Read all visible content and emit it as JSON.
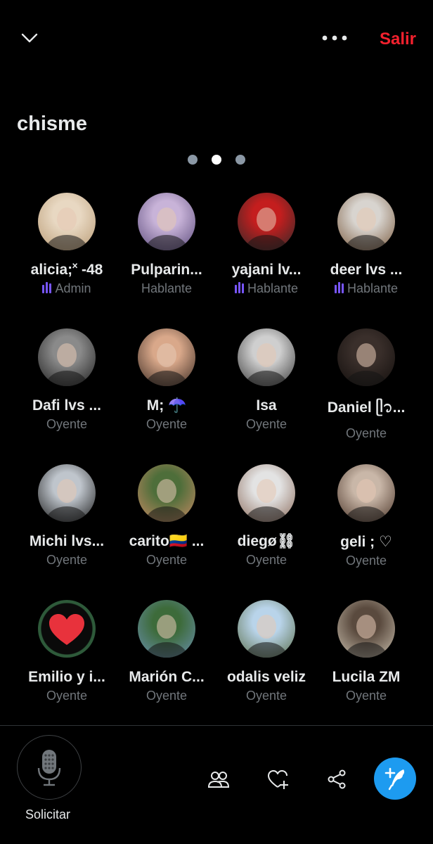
{
  "header": {
    "collapse_icon": "chevron-down-icon",
    "more_icon": "more-horizontal-icon",
    "exit_label": "Salir"
  },
  "space": {
    "title": "chisme"
  },
  "pager": {
    "pages": 3,
    "active_index": 1
  },
  "participants": [
    {
      "name": "alicia;˟ -48",
      "role": "Admin",
      "speaking": true,
      "colors": [
        "#e8d8c2",
        "#b89a74"
      ]
    },
    {
      "name": "Pulparin...",
      "role": "Hablante",
      "speaking": false,
      "colors": [
        "#c8b3d8",
        "#5a4a7a"
      ]
    },
    {
      "name": "yajani lv...",
      "role": "Hablante",
      "speaking": true,
      "colors": [
        "#c41e1e",
        "#2a2a2a"
      ]
    },
    {
      "name": "deer lvs ...",
      "role": "Hablante",
      "speaking": true,
      "colors": [
        "#d8d4cf",
        "#7a5a3e"
      ]
    },
    {
      "name": "Dafi lvs ...",
      "role": "Oyente",
      "speaking": false,
      "colors": [
        "#8a8a8a",
        "#1e1e1e"
      ]
    },
    {
      "name": "M; ☂️",
      "role": "Oyente",
      "speaking": false,
      "colors": [
        "#d9a88a",
        "#3a2a22"
      ]
    },
    {
      "name": "Isa",
      "role": "Oyente",
      "speaking": false,
      "colors": [
        "#cfcfcf",
        "#3a3a3a"
      ]
    },
    {
      "name": "Daniel ᥫ᭡...",
      "role": "Oyente",
      "speaking": false,
      "colors": [
        "#3a2f2b",
        "#120e0c"
      ]
    },
    {
      "name": "Michi lvs...",
      "role": "Oyente",
      "speaking": false,
      "colors": [
        "#bfc5cc",
        "#1a1a1a"
      ]
    },
    {
      "name": "carito🇨🇴 ...",
      "role": "Oyente",
      "speaking": false,
      "colors": [
        "#4e6e3a",
        "#c98a64"
      ]
    },
    {
      "name": "diegø⛓",
      "role": "Oyente",
      "speaking": false,
      "colors": [
        "#e3e3e3",
        "#8a6a5a"
      ]
    },
    {
      "name": "geli ; ♡",
      "role": "Oyente",
      "speaking": false,
      "colors": [
        "#c9b7a8",
        "#4a3428"
      ]
    },
    {
      "name": "Emilio y i...",
      "role": "Oyente",
      "speaking": false,
      "colors": [
        "#0a0a0a",
        "#2e5a3a"
      ],
      "heart": true
    },
    {
      "name": "Marión C...",
      "role": "Oyente",
      "speaking": false,
      "colors": [
        "#3d6b3a",
        "#6a8fb0"
      ]
    },
    {
      "name": "odalis veliz",
      "role": "Oyente",
      "speaking": false,
      "colors": [
        "#b9d4ea",
        "#5a6e4a"
      ]
    },
    {
      "name": "Lucila ZM",
      "role": "Oyente",
      "speaking": false,
      "colors": [
        "#5a4a3e",
        "#c9bfae"
      ]
    }
  ],
  "bottom": {
    "mic_label": "Solicitar",
    "mic_icon": "microphone-icon",
    "people_icon": "people-icon",
    "heart_icon": "heart-plus-icon",
    "share_icon": "share-icon",
    "compose_icon": "compose-feather-icon",
    "accent": "#1d9bf0"
  },
  "colors": {
    "exit": "#f4212e",
    "speaking_bars": "#7856ff",
    "muted_text": "#71767b"
  }
}
